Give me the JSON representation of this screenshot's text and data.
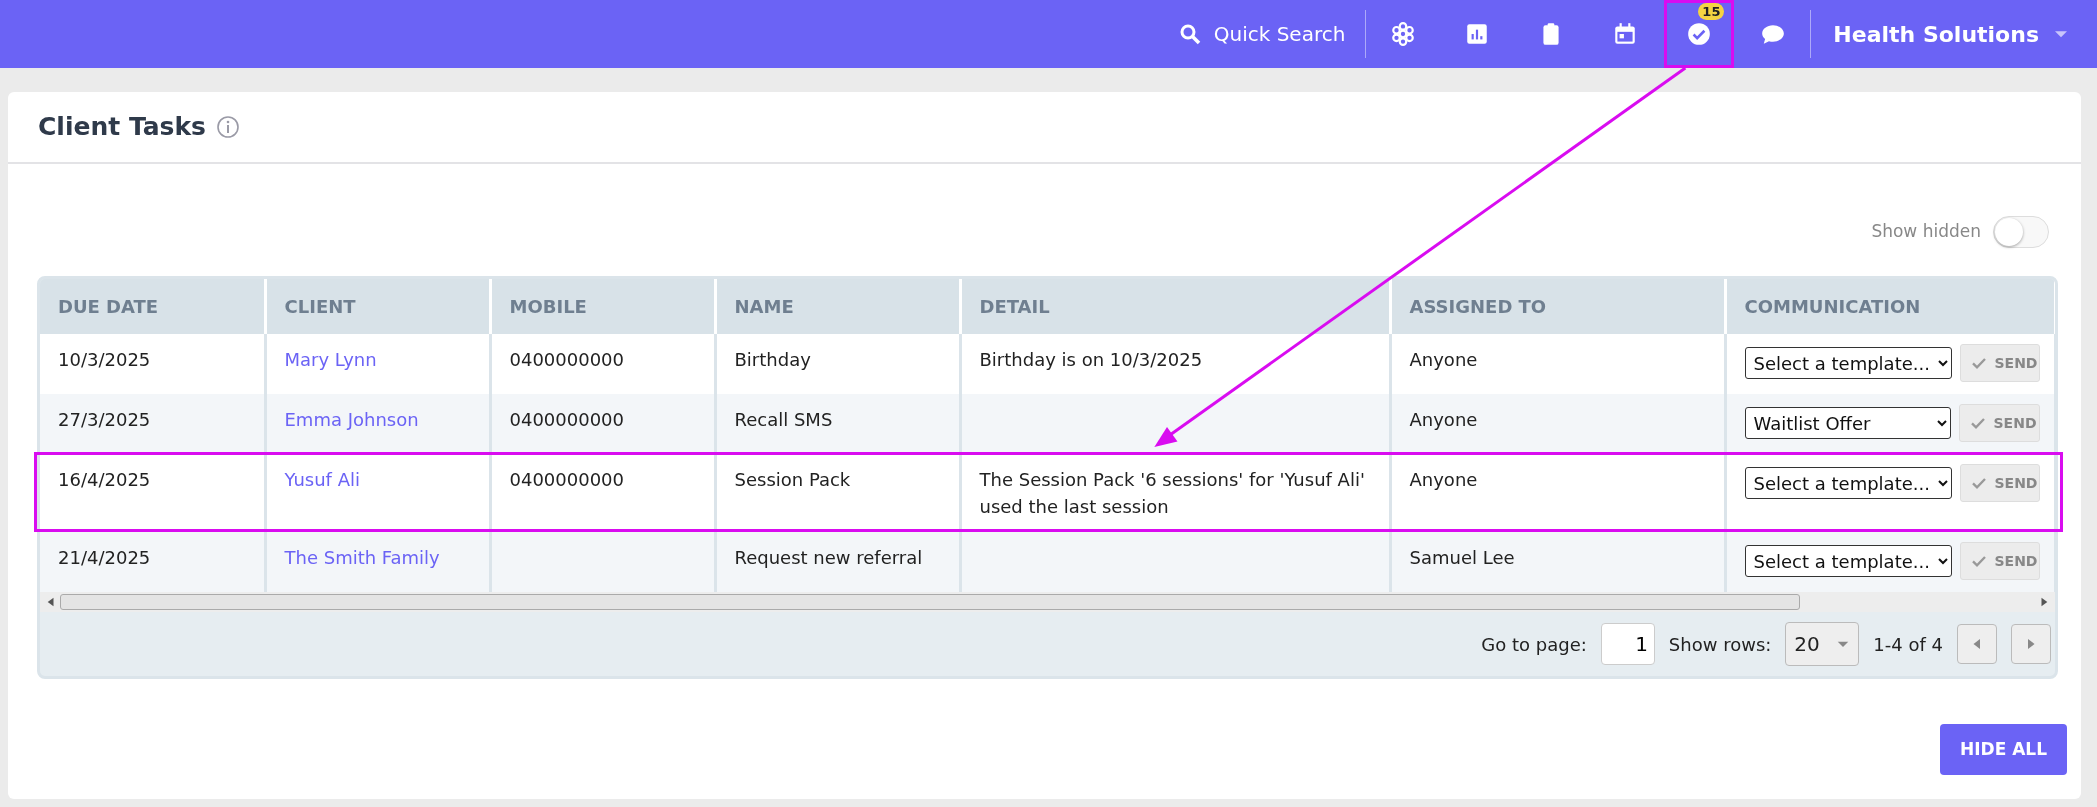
{
  "topbar": {
    "search_label": "Quick Search",
    "icons": [
      {
        "kind": "apps",
        "highlighted": false
      },
      {
        "kind": "chart",
        "highlighted": false
      },
      {
        "kind": "clipboard",
        "highlighted": false
      },
      {
        "kind": "calendar",
        "highlighted": false
      },
      {
        "kind": "tasks",
        "badge": "15",
        "highlighted": true
      },
      {
        "kind": "chat",
        "highlighted": false
      }
    ],
    "account": "Health Solutions"
  },
  "card": {
    "title": "Client Tasks"
  },
  "show_hidden": {
    "label": "Show hidden",
    "on": false
  },
  "table": {
    "columns": [
      "DUE DATE",
      "CLIENT",
      "MOBILE",
      "NAME",
      "DETAIL",
      "ASSIGNED TO",
      "COMMUNICATION"
    ],
    "rows": [
      {
        "due_date": "10/3/2025",
        "client": "Mary Lynn",
        "mobile": "0400000000",
        "name": "Birthday",
        "detail": "Birthday is on 10/3/2025",
        "assigned_to": "Anyone",
        "template": "Select a template...",
        "send": "SEND",
        "highlighted": false
      },
      {
        "due_date": "27/3/2025",
        "client": "Emma Johnson",
        "mobile": "0400000000",
        "name": "Recall SMS",
        "detail": "",
        "assigned_to": "Anyone",
        "template": "Waitlist Offer",
        "send": "SEND",
        "highlighted": false
      },
      {
        "due_date": "16/4/2025",
        "client": "Yusuf Ali",
        "mobile": "0400000000",
        "name": "Session Pack",
        "detail": "The Session Pack '6 sessions' for 'Yusuf Ali' used the last session",
        "assigned_to": "Anyone",
        "template": "Select a template...",
        "send": "SEND",
        "highlighted": true
      },
      {
        "due_date": "21/4/2025",
        "client": "The Smith Family",
        "mobile": "",
        "name": "Request new referral",
        "detail": "",
        "assigned_to": "Samuel Lee",
        "template": "Select a template...",
        "send": "SEND",
        "highlighted": false
      }
    ]
  },
  "pagination": {
    "go_to_label": "Go to page:",
    "page": "1",
    "rows_label": "Show rows:",
    "rows": "20",
    "range": "1-4 of 4"
  },
  "hide_all_button": "HIDE ALL"
}
